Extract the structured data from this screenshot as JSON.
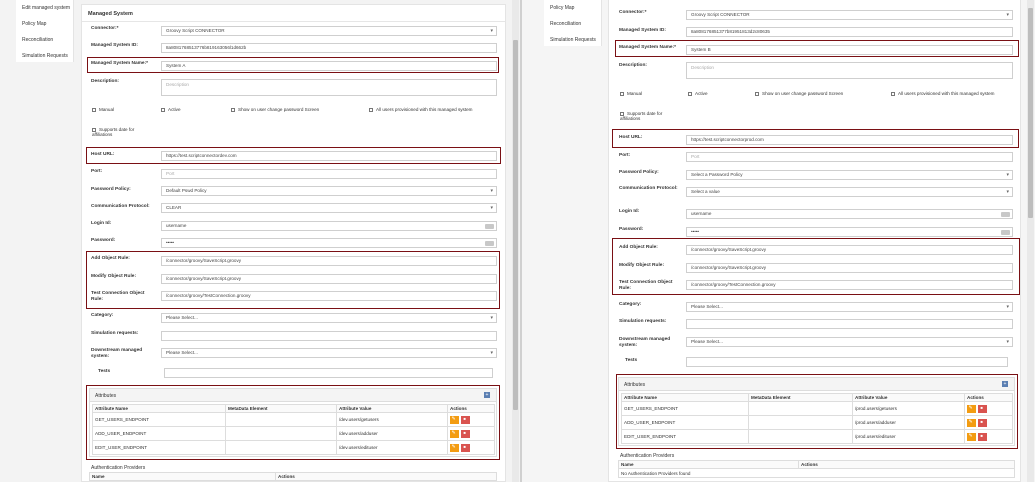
{
  "left": {
    "menu": [
      "Edit managed system",
      "Policy Map",
      "Reconciliation",
      "Simulation Requests"
    ],
    "card_title": "Managed System",
    "fields": {
      "connector": {
        "label": "Connector:*",
        "value": "Groovy Script CONNECTOR"
      },
      "msid": {
        "label": "Managed System ID:",
        "value": "8a8081768513776b819163056l1d662b"
      },
      "name": {
        "label": "Managed System Name:*",
        "value": "System A"
      },
      "desc": {
        "label": "Description:",
        "placeholder": "Description"
      },
      "host": {
        "label": "Host URL:",
        "value": "https://test.scriptconnectordev.com"
      },
      "port": {
        "label": "Port:",
        "placeholder": "Port"
      },
      "policy": {
        "label": "Password Policy:",
        "value": "Default Pswd Policy"
      },
      "protocol": {
        "label": "Communication Protocol:",
        "value": "CLEAR"
      },
      "login": {
        "label": "Login Id:",
        "value": "username"
      },
      "password": {
        "label": "Password:",
        "value": "•••••"
      },
      "add_rule": {
        "label": "Add Object Rule:",
        "value": "/connector/groovy/SaveScript.groovy"
      },
      "mod_rule": {
        "label": "Modify Object Rule:",
        "value": "/connector/groovy/SaveScript.groovy"
      },
      "test_rule": {
        "label": "Test Connection Object Rule:",
        "value": "/connector/groovy/TestConnection.groovy"
      },
      "category": {
        "label": "Category:",
        "value": "Please Select..."
      },
      "simreq": {
        "label": "Simulation requests:",
        "value": ""
      },
      "downstream": {
        "label": "Downstream managed system:",
        "value": "Please Select..."
      },
      "tests": {
        "label": "Tests",
        "value": ""
      }
    },
    "checks": [
      "Manual",
      "Active",
      "Show on user change password Screen",
      "All users provisioned with this managed system",
      "Supports date for affiliations"
    ],
    "attributes": {
      "title": "Attributes",
      "columns": [
        "Attribute Name",
        "MetaData Element",
        "Attribute Value",
        "Actions"
      ],
      "rows": [
        [
          "GET_USERS_ENDPOINT",
          "",
          "/dev.users/getusers"
        ],
        [
          "ADD_USER_ENDPOINT",
          "",
          "/dev.users/adduser"
        ],
        [
          "EDIT_USER_ENDPOINT",
          "",
          "/dev.users/edituser"
        ]
      ]
    },
    "auth": {
      "title": "Authentication Providers",
      "columns": [
        "Name",
        "Actions"
      ]
    }
  },
  "right": {
    "menu": [
      "Policy Map",
      "Reconciliation",
      "Simulation Requests"
    ],
    "fields": {
      "connector": {
        "label": "Connector:*",
        "value": "Groovy Script CONNECTOR"
      },
      "msid": {
        "label": "Managed System ID:",
        "value": "8a808176851377b81951813d2c80635"
      },
      "name": {
        "label": "Managed System Name:*",
        "value": "System B"
      },
      "desc": {
        "label": "Description:",
        "placeholder": "Description"
      },
      "host": {
        "label": "Host URL:",
        "value": "https://test.scriptconnectorprod.com"
      },
      "port": {
        "label": "Port:",
        "placeholder": "Port"
      },
      "policy": {
        "label": "Password Policy:",
        "value": "Select a Password Policy"
      },
      "protocol": {
        "label": "Communication Protocol:",
        "value": "Select a value"
      },
      "login": {
        "label": "Login Id:",
        "value": "username"
      },
      "password": {
        "label": "Password:",
        "value": "•••••"
      },
      "add_rule": {
        "label": "Add Object Rule:",
        "value": "/connector/groovy/SaveScript.groovy"
      },
      "mod_rule": {
        "label": "Modify Object Rule:",
        "value": "/connector/groovy/SaveScript.groovy"
      },
      "test_rule": {
        "label": "Test Connection Object Rule:",
        "value": "/connector/groovy/TestConnection.groovy"
      },
      "category": {
        "label": "Category:",
        "value": "Please Select..."
      },
      "simreq": {
        "label": "Simulation requests:",
        "value": ""
      },
      "downstream": {
        "label": "Downstream managed system:",
        "value": "Please Select..."
      },
      "tests": {
        "label": "Tests",
        "value": ""
      }
    },
    "checks": [
      "Manual",
      "Active",
      "Show on user change password Screen",
      "All users provisioned with this managed system",
      "Supports date for affiliations"
    ],
    "attributes": {
      "title": "Attributes",
      "columns": [
        "Attribute Name",
        "MetaData Element",
        "Attribute Value",
        "Actions"
      ],
      "rows": [
        [
          "GET_USERS_ENDPOINT",
          "",
          "/prod.users/getusers"
        ],
        [
          "ADD_USER_ENDPOINT",
          "",
          "/prod.users/adduser"
        ],
        [
          "EDIT_USER_ENDPOINT",
          "",
          "/prod.users/edituser"
        ]
      ]
    },
    "auth": {
      "title": "Authentication Providers",
      "columns": [
        "Name",
        "Actions"
      ],
      "empty": "No Authentication Providers found"
    }
  }
}
